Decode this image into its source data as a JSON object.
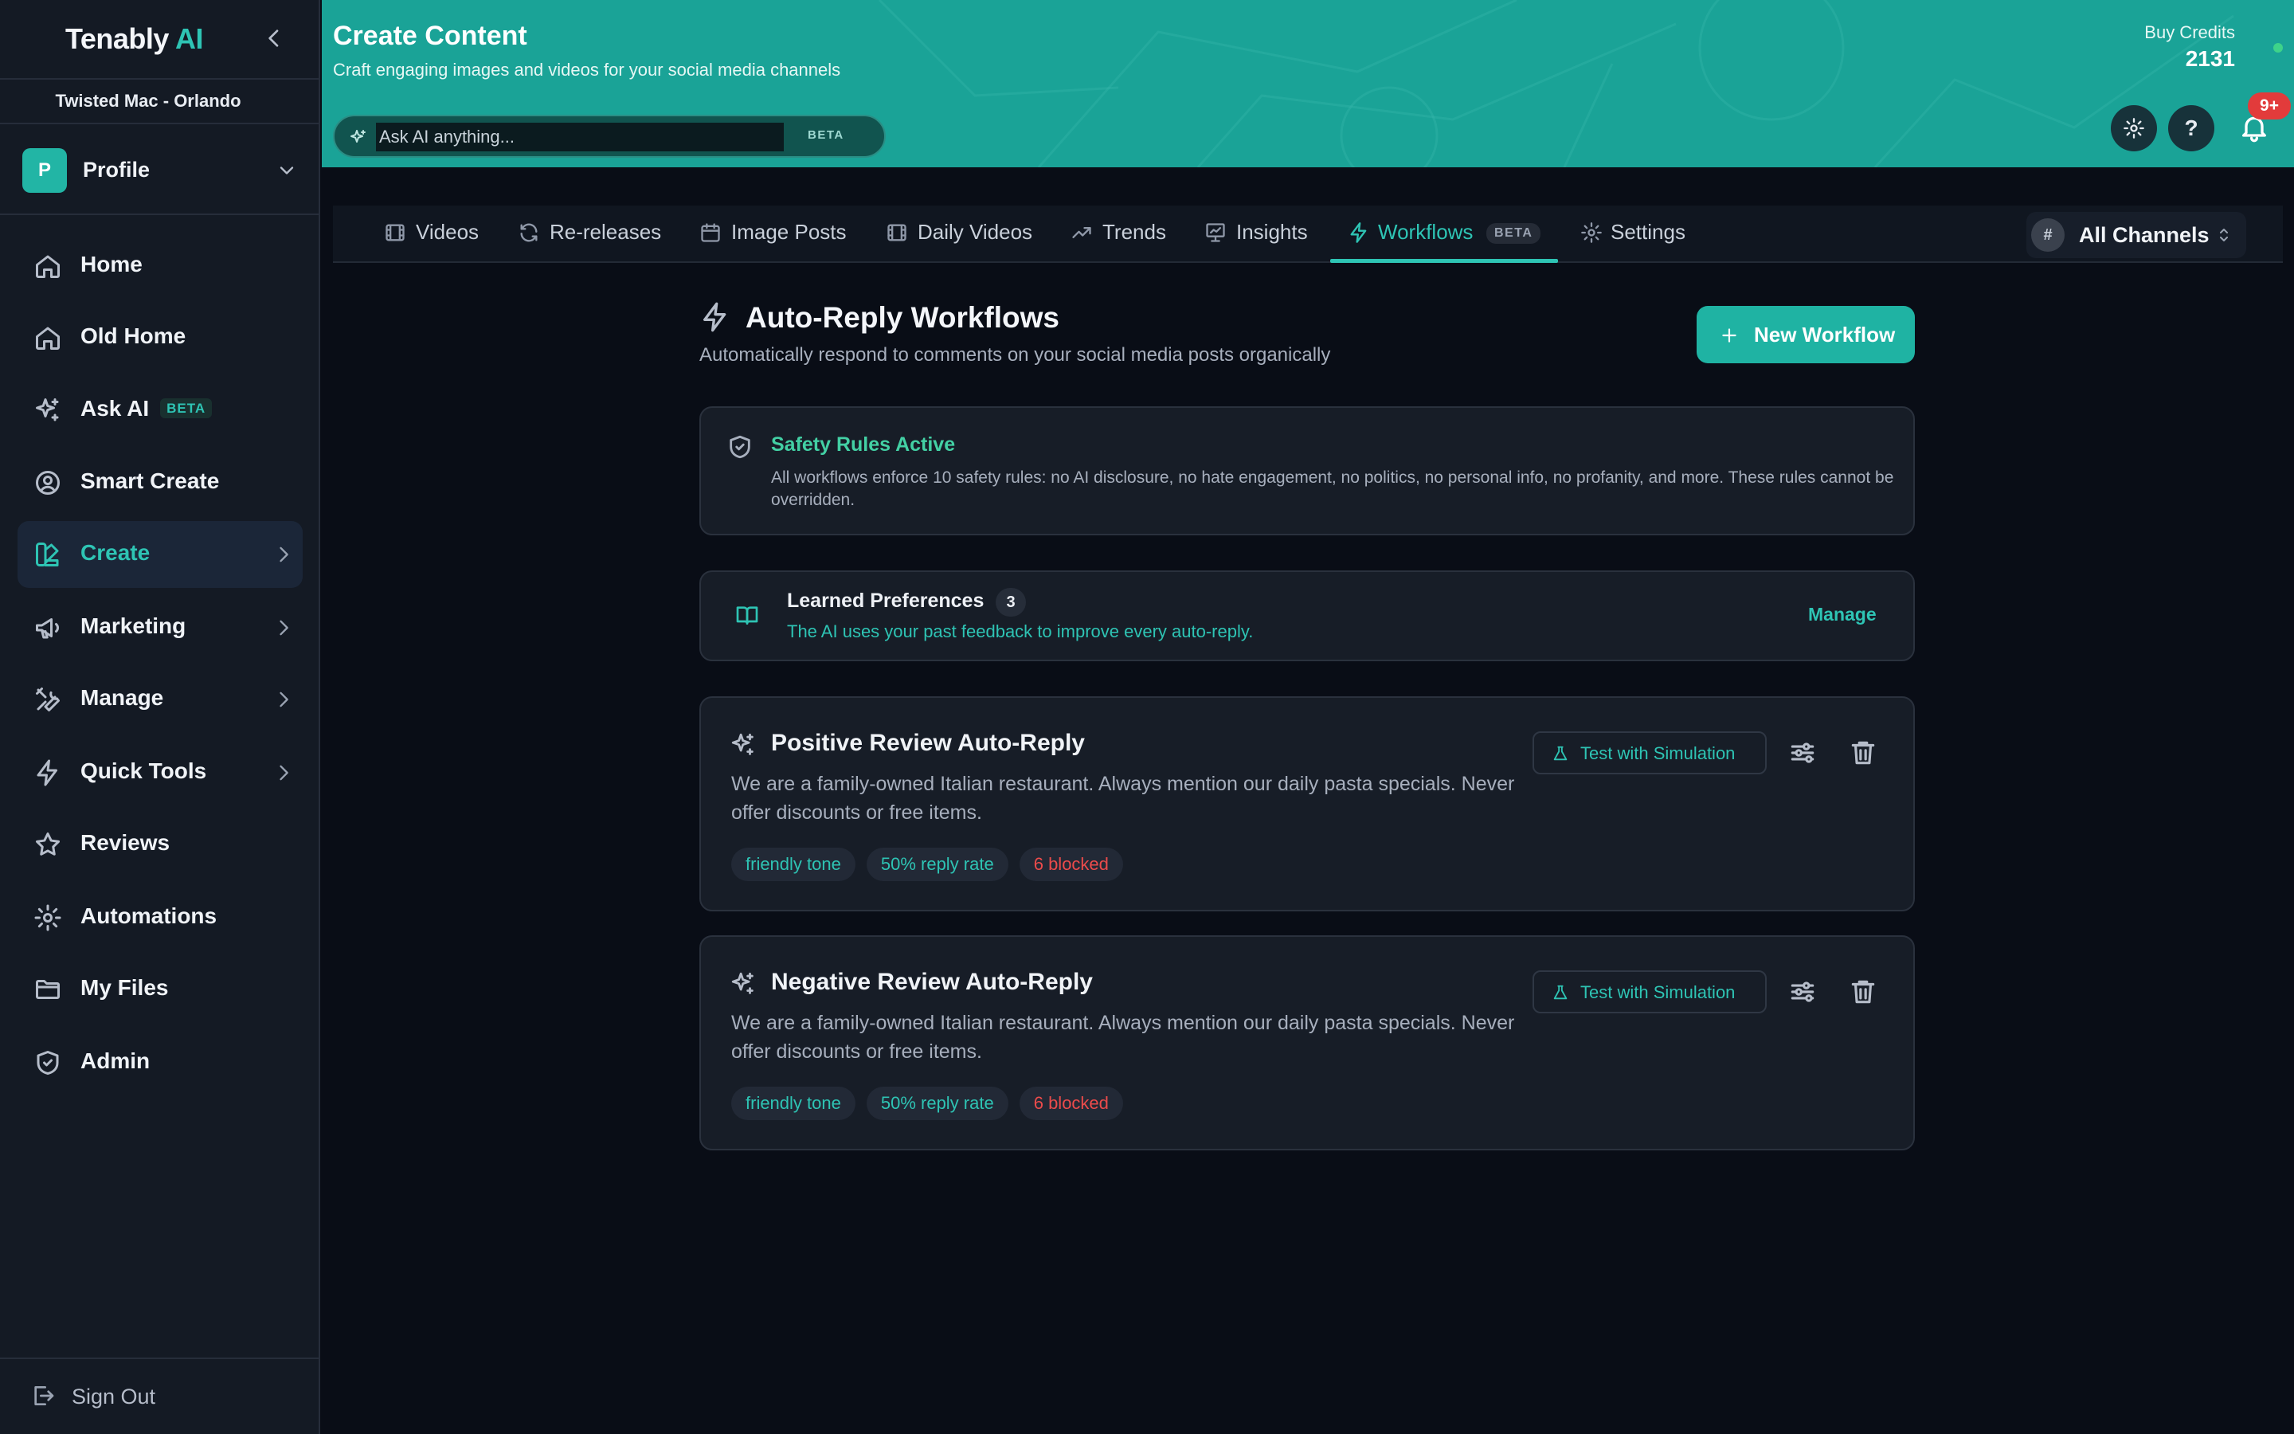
{
  "brand": {
    "name": "Tenably",
    "ai": "AI"
  },
  "location": "Twisted Mac - Orlando",
  "profile": {
    "initial": "P",
    "label": "Profile"
  },
  "nav": {
    "items": [
      {
        "label": "Home",
        "icon": "home-icon"
      },
      {
        "label": "Old Home",
        "icon": "home-icon"
      },
      {
        "label": "Ask AI",
        "badge": "BETA",
        "icon": "sparkles-icon"
      },
      {
        "label": "Smart Create",
        "icon": "user-circle-icon"
      },
      {
        "label": "Create",
        "icon": "palette-icon",
        "active": true
      },
      {
        "label": "Marketing",
        "icon": "megaphone-icon"
      },
      {
        "label": "Manage",
        "icon": "tools-icon"
      },
      {
        "label": "Quick Tools",
        "icon": "bolt-icon"
      },
      {
        "label": "Reviews",
        "icon": "star-icon"
      },
      {
        "label": "Automations",
        "icon": "gear-icon"
      },
      {
        "label": "My Files",
        "icon": "folder-icon"
      },
      {
        "label": "Admin",
        "icon": "shield-icon"
      }
    ],
    "sign_out": "Sign Out"
  },
  "header": {
    "title": "Create Content",
    "subtitle": "Craft engaging images and videos for your social media channels",
    "ask_placeholder": "Ask AI anything...",
    "ask_badge": "BETA",
    "credits_label": "Buy Credits",
    "credits_value": "2131",
    "help": "?",
    "notifications": "9+"
  },
  "tabs": [
    {
      "label": "Videos",
      "icon": "film-icon"
    },
    {
      "label": "Re-releases",
      "icon": "refresh-icon"
    },
    {
      "label": "Image Posts",
      "icon": "calendar-icon"
    },
    {
      "label": "Daily Videos",
      "icon": "film-icon"
    },
    {
      "label": "Trends",
      "icon": "trend-icon"
    },
    {
      "label": "Insights",
      "icon": "presentation-icon"
    },
    {
      "label": "Workflows",
      "badge": "BETA",
      "icon": "bolt-icon",
      "active": true
    },
    {
      "label": "Settings",
      "icon": "gear-icon"
    }
  ],
  "channels": {
    "symbol": "#",
    "label": "All Channels"
  },
  "section": {
    "title": "Auto-Reply Workflows",
    "subtitle": "Automatically respond to comments on your social media posts organically",
    "new_button": "New Workflow"
  },
  "safety": {
    "title": "Safety Rules Active",
    "description": "All workflows enforce 10 safety rules: no AI disclosure, no hate engagement, no politics, no personal info, no profanity, and more. These rules cannot be overridden."
  },
  "learned": {
    "title": "Learned Preferences",
    "count": "3",
    "description": "The AI uses your past feedback to improve every auto-reply.",
    "manage": "Manage"
  },
  "workflows": [
    {
      "title": "Positive Review Auto-Reply",
      "description": "We are a family-owned Italian restaurant. Always mention our daily pasta specials. Never offer discounts or free items.",
      "tags": [
        "friendly tone",
        "50% reply rate",
        "6 blocked"
      ],
      "test_button": "Test with Simulation"
    },
    {
      "title": "Negative Review Auto-Reply",
      "description": "We are a family-owned Italian restaurant. Always mention our daily pasta specials. Never offer discounts or free items.",
      "tags": [
        "friendly tone",
        "50% reply rate",
        "6 blocked"
      ],
      "test_button": "Test with Simulation"
    }
  ],
  "colors": {
    "accent": "#2ec4b4",
    "header": "#1aa397",
    "danger": "#ec4b4b",
    "background": "#090d16"
  }
}
